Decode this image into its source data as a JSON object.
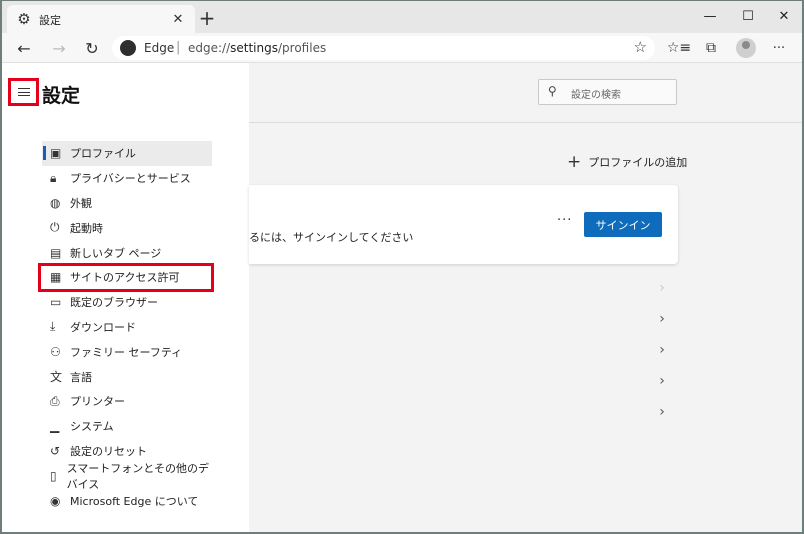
{
  "tab": {
    "title": "設定",
    "favicon": "gear-icon",
    "close": "✕"
  },
  "window_controls": {
    "minimize": "—",
    "maximize": "☐",
    "close": "✕"
  },
  "toolbar": {
    "new_tab": "+",
    "back": "←",
    "forward": "→",
    "refresh": "↻",
    "site_name": "Edge",
    "url_prefix": "edge://",
    "url_main": "settings",
    "url_suffix": "/profiles",
    "favorites_star": "☆",
    "more": "···"
  },
  "sidebar": {
    "title": "設定",
    "items": [
      {
        "label": "プロファイル",
        "icon": "profile-icon",
        "glyph": "▣",
        "active": true
      },
      {
        "label": "プライバシーとサービス",
        "icon": "lock-icon",
        "glyph": "🔒︎"
      },
      {
        "label": "外観",
        "icon": "palette-icon",
        "glyph": "◍"
      },
      {
        "label": "起動時",
        "icon": "power-icon",
        "glyph": "⏻"
      },
      {
        "label": "新しいタブ ページ",
        "icon": "newtab-page-icon",
        "glyph": "▤"
      },
      {
        "label": "サイトのアクセス許可",
        "icon": "site-permissions-icon",
        "glyph": "▦",
        "highlighted": true
      },
      {
        "label": "既定のブラウザー",
        "icon": "browser-icon",
        "glyph": "▭"
      },
      {
        "label": "ダウンロード",
        "icon": "download-icon",
        "glyph": "⤓"
      },
      {
        "label": "ファミリー セーフティ",
        "icon": "family-icon",
        "glyph": "⚇"
      },
      {
        "label": "言語",
        "icon": "language-icon",
        "glyph": "文"
      },
      {
        "label": "プリンター",
        "icon": "printer-icon",
        "glyph": "⎙"
      },
      {
        "label": "システム",
        "icon": "system-icon",
        "glyph": "▁"
      },
      {
        "label": "設定のリセット",
        "icon": "reset-icon",
        "glyph": "↺"
      },
      {
        "label": "スマートフォンとその他のデバイス",
        "icon": "phone-icon",
        "glyph": "▯"
      },
      {
        "label": "Microsoft Edge について",
        "icon": "edge-logo-icon",
        "glyph": "◉"
      }
    ]
  },
  "search": {
    "placeholder": "設定の検索"
  },
  "main": {
    "add_profile": "プロファイルの追加",
    "card_message": "るには、サインインしてください",
    "card_more": "···",
    "signin_button": "サインイン",
    "chevron": "›"
  },
  "colors": {
    "accent": "#0f6cbd",
    "highlight_border": "#e4001b",
    "active_indicator": "#1f5db4"
  }
}
